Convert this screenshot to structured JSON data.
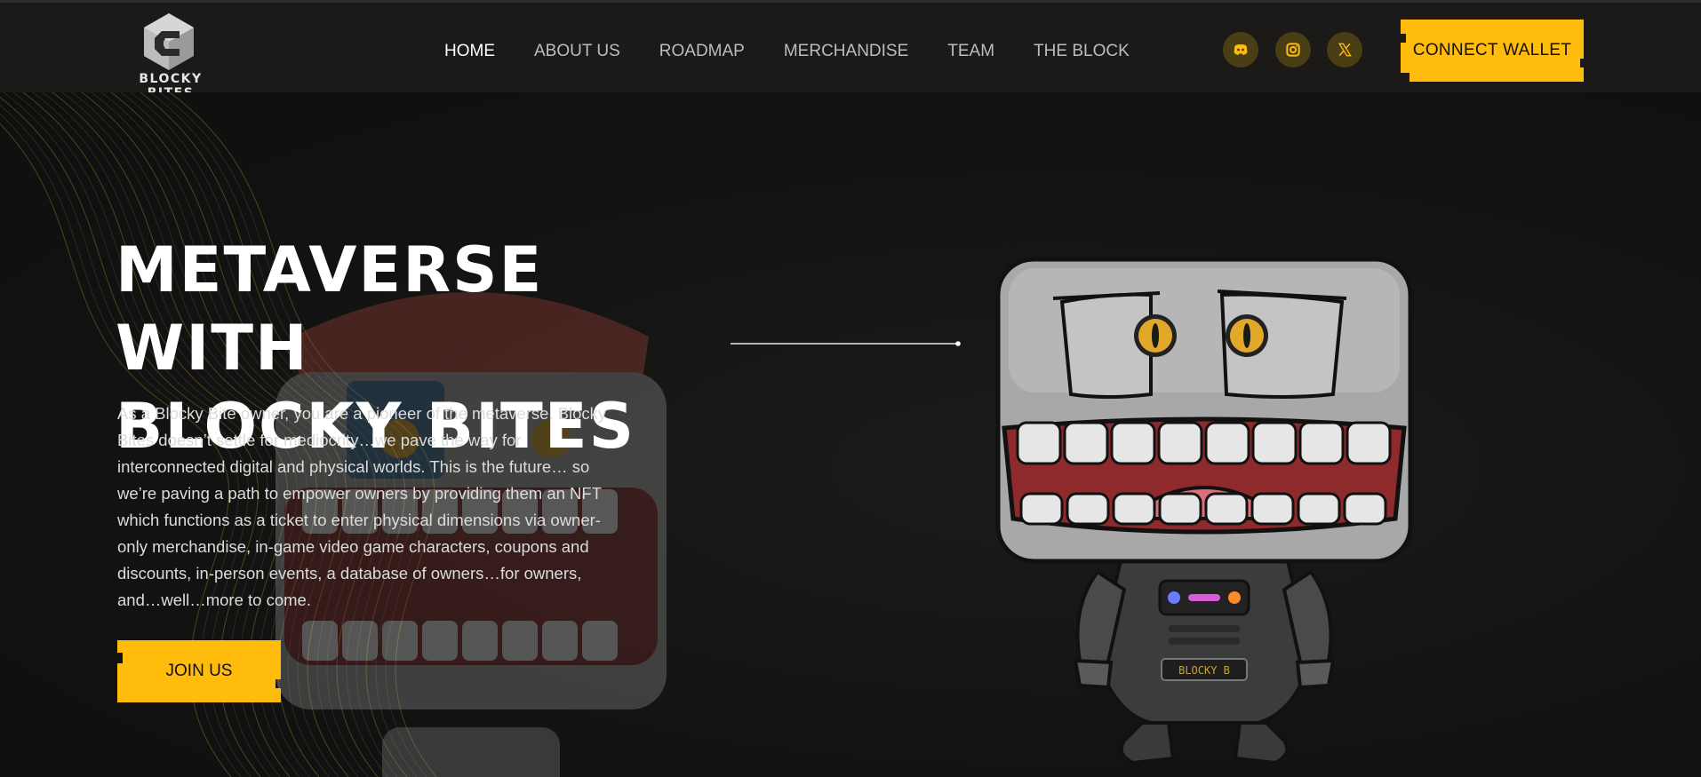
{
  "brand": {
    "name": "BLOCKY BITES"
  },
  "nav": {
    "items": [
      {
        "label": "HOME",
        "active": true
      },
      {
        "label": "ABOUT US",
        "active": false
      },
      {
        "label": "ROADMAP",
        "active": false
      },
      {
        "label": "MERCHANDISE",
        "active": false
      },
      {
        "label": "TEAM",
        "active": false
      },
      {
        "label": "THE BLOCK",
        "active": false
      }
    ]
  },
  "social": [
    {
      "icon": "discord-icon"
    },
    {
      "icon": "instagram-icon"
    },
    {
      "icon": "x-icon"
    }
  ],
  "header": {
    "connect_label": "CONNECT WALLET"
  },
  "hero": {
    "title_line1": "METAVERSE WITH",
    "title_line2": "BLOCKY BITES",
    "body": "As a Blocky Bite owner, you are a pioneer of the metaverse. Blocky Bites doesn’t settle for mediocrity…we pave the way for interconnected digital and physical worlds. This is the future… so we’re paving a path to empower owners by providing them an NFT which functions as a ticket to enter physical dimensions via owner-only merchandise, in-game video game characters, coupons and discounts, in-person events, a database of owners…for owners, and…well…more to come.",
    "join_label": "JOIN US",
    "robot_badge": "BLOCKY B"
  },
  "colors": {
    "accent": "#ffbc0d",
    "background": "#131313",
    "header": "#1b1a18"
  }
}
